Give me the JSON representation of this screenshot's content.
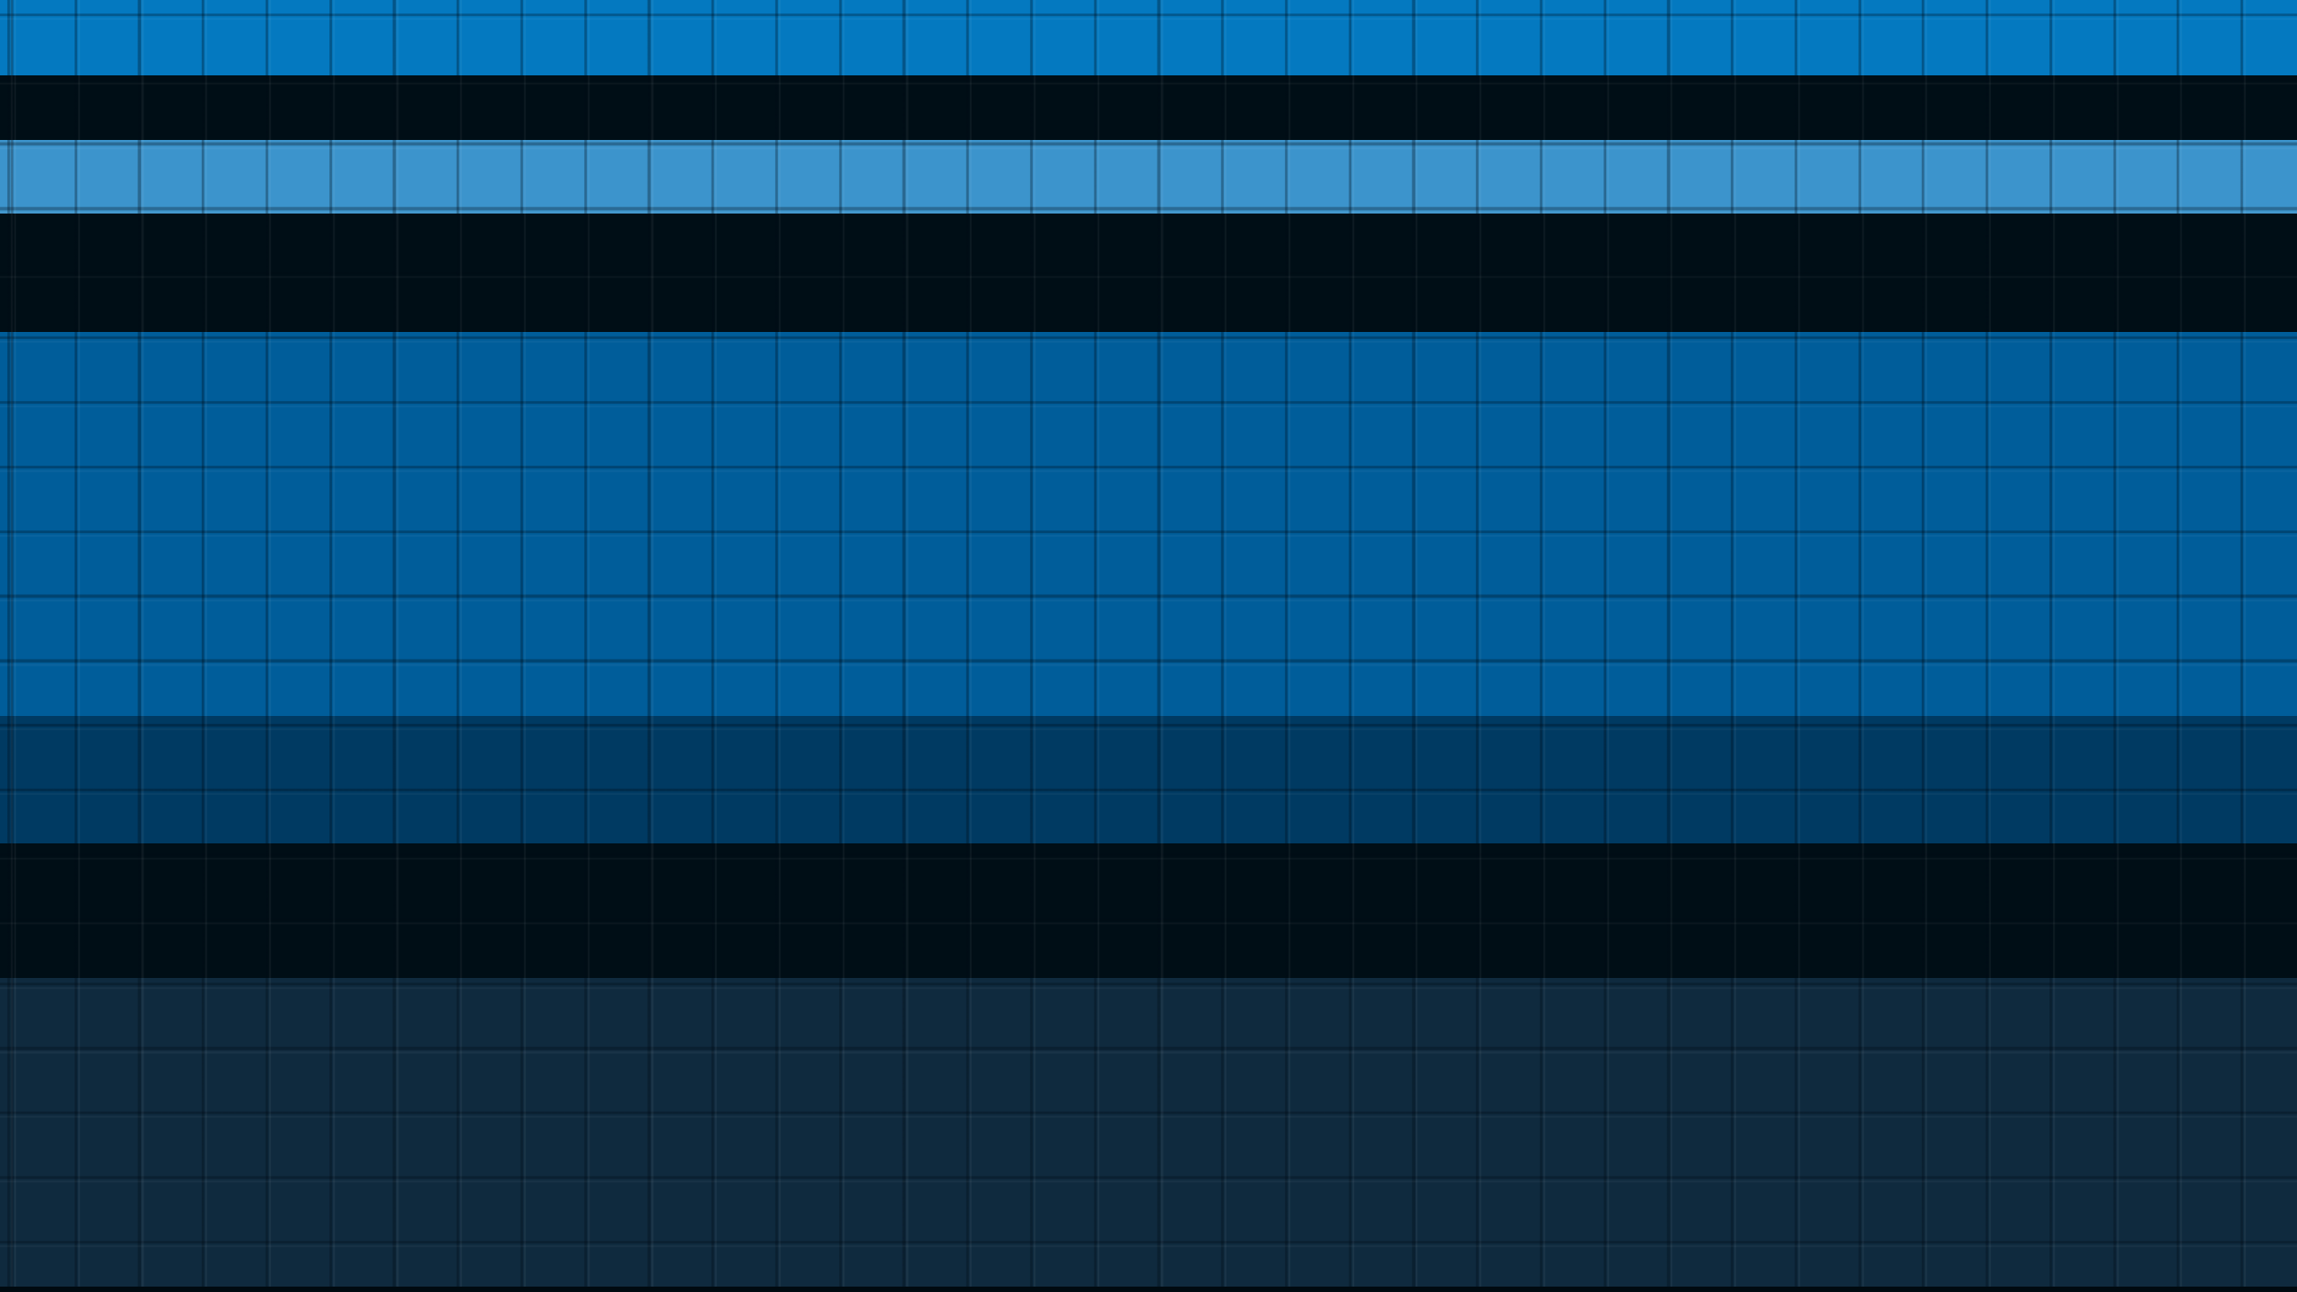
{
  "desktop": {
    "wallpaper": {
      "style": "horizontal striped tile texture",
      "bands": [
        {
          "name": "band-1",
          "color": "#0479c0"
        },
        {
          "name": "band-2",
          "color": "#000e16"
        },
        {
          "name": "band-3",
          "color": "#3c94cc"
        },
        {
          "name": "band-4",
          "color": "#000e16"
        },
        {
          "name": "band-5",
          "color": "#005d9a"
        },
        {
          "name": "band-6",
          "color": "#003a62"
        },
        {
          "name": "band-7",
          "color": "#000e16"
        },
        {
          "name": "band-8",
          "color": "#0f2a3e"
        }
      ]
    }
  }
}
